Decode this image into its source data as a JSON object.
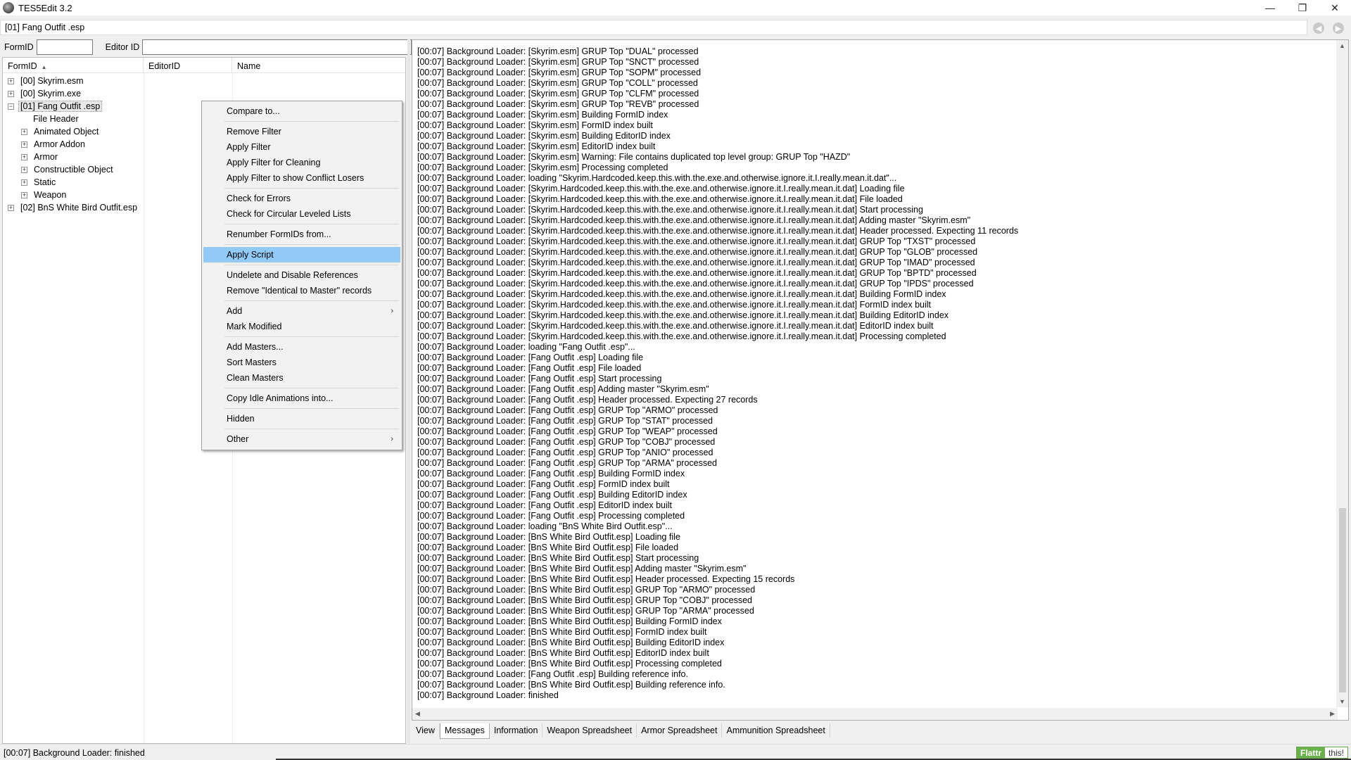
{
  "window": {
    "title": "TES5Edit 3.2",
    "controls": {
      "minimize": "—",
      "restore": "❐",
      "close": "✕"
    }
  },
  "pathbar": {
    "path": "[01] Fang Outfit .esp"
  },
  "nav": {
    "back": "◀",
    "forward": "▶"
  },
  "filter": {
    "formid_label": "FormID",
    "editorid_label": "Editor ID",
    "formid_value": "",
    "editorid_value": ""
  },
  "tree": {
    "columns": {
      "formid": "FormID",
      "editorid": "EditorID",
      "name": "Name"
    },
    "rows": [
      {
        "label": "[00] Skyrim.esm",
        "expander": "+",
        "level": 0
      },
      {
        "label": "[00] Skyrim.exe",
        "expander": "+",
        "level": 0
      },
      {
        "label": "[01] Fang Outfit .esp",
        "expander": "−",
        "level": 0,
        "selected": true
      },
      {
        "label": "File Header",
        "expander": "",
        "level": 1
      },
      {
        "label": "Animated Object",
        "expander": "+",
        "level": 1
      },
      {
        "label": "Armor Addon",
        "expander": "+",
        "level": 1
      },
      {
        "label": "Armor",
        "expander": "+",
        "level": 1
      },
      {
        "label": "Constructible Object",
        "expander": "+",
        "level": 1
      },
      {
        "label": "Static",
        "expander": "+",
        "level": 1
      },
      {
        "label": "Weapon",
        "expander": "+",
        "level": 1
      },
      {
        "label": "[02] BnS White Bird Outfit.esp",
        "expander": "+",
        "level": 0
      }
    ]
  },
  "context_menu": {
    "compare": "Compare to...",
    "remove_filter": "Remove Filter",
    "apply_filter": "Apply Filter",
    "apply_filter_cleaning": "Apply Filter for Cleaning",
    "apply_filter_conflict": "Apply Filter to show Conflict Losers",
    "check_errors": "Check for Errors",
    "check_circular": "Check for Circular Leveled Lists",
    "renumber": "Renumber FormIDs from...",
    "apply_script": "Apply Script",
    "undelete": "Undelete and Disable References",
    "remove_itm": "Remove \"Identical to Master\" records",
    "add": "Add",
    "mark_modified": "Mark Modified",
    "add_masters": "Add Masters...",
    "sort_masters": "Sort Masters",
    "clean_masters": "Clean Masters",
    "copy_idle": "Copy Idle Animations into...",
    "hidden": "Hidden",
    "other": "Other",
    "submenu_arrow": "›"
  },
  "log": {
    "lines": [
      "[00:07] Background Loader: [Skyrim.esm] GRUP Top \"DUAL\" processed",
      "[00:07] Background Loader: [Skyrim.esm] GRUP Top \"SNCT\" processed",
      "[00:07] Background Loader: [Skyrim.esm] GRUP Top \"SOPM\" processed",
      "[00:07] Background Loader: [Skyrim.esm] GRUP Top \"COLL\" processed",
      "[00:07] Background Loader: [Skyrim.esm] GRUP Top \"CLFM\" processed",
      "[00:07] Background Loader: [Skyrim.esm] GRUP Top \"REVB\" processed",
      "[00:07] Background Loader: [Skyrim.esm] Building FormID index",
      "[00:07] Background Loader: [Skyrim.esm] FormID index built",
      "[00:07] Background Loader: [Skyrim.esm] Building EditorID index",
      "[00:07] Background Loader: [Skyrim.esm] EditorID index built",
      "[00:07] Background Loader: [Skyrim.esm] Warning: File contains duplicated top level group: GRUP Top \"HAZD\"",
      "[00:07] Background Loader: [Skyrim.esm] Processing completed",
      "[00:07] Background Loader: loading \"Skyrim.Hardcoded.keep.this.with.the.exe.and.otherwise.ignore.it.I.really.mean.it.dat\"...",
      "[00:07] Background Loader: [Skyrim.Hardcoded.keep.this.with.the.exe.and.otherwise.ignore.it.I.really.mean.it.dat] Loading file",
      "[00:07] Background Loader: [Skyrim.Hardcoded.keep.this.with.the.exe.and.otherwise.ignore.it.I.really.mean.it.dat] File loaded",
      "[00:07] Background Loader: [Skyrim.Hardcoded.keep.this.with.the.exe.and.otherwise.ignore.it.I.really.mean.it.dat] Start processing",
      "[00:07] Background Loader: [Skyrim.Hardcoded.keep.this.with.the.exe.and.otherwise.ignore.it.I.really.mean.it.dat] Adding master \"Skyrim.esm\"",
      "[00:07] Background Loader: [Skyrim.Hardcoded.keep.this.with.the.exe.and.otherwise.ignore.it.I.really.mean.it.dat] Header processed. Expecting 11 records",
      "[00:07] Background Loader: [Skyrim.Hardcoded.keep.this.with.the.exe.and.otherwise.ignore.it.I.really.mean.it.dat] GRUP Top \"TXST\" processed",
      "[00:07] Background Loader: [Skyrim.Hardcoded.keep.this.with.the.exe.and.otherwise.ignore.it.I.really.mean.it.dat] GRUP Top \"GLOB\" processed",
      "[00:07] Background Loader: [Skyrim.Hardcoded.keep.this.with.the.exe.and.otherwise.ignore.it.I.really.mean.it.dat] GRUP Top \"IMAD\" processed",
      "[00:07] Background Loader: [Skyrim.Hardcoded.keep.this.with.the.exe.and.otherwise.ignore.it.I.really.mean.it.dat] GRUP Top \"BPTD\" processed",
      "[00:07] Background Loader: [Skyrim.Hardcoded.keep.this.with.the.exe.and.otherwise.ignore.it.I.really.mean.it.dat] GRUP Top \"IPDS\" processed",
      "[00:07] Background Loader: [Skyrim.Hardcoded.keep.this.with.the.exe.and.otherwise.ignore.it.I.really.mean.it.dat] Building FormID index",
      "[00:07] Background Loader: [Skyrim.Hardcoded.keep.this.with.the.exe.and.otherwise.ignore.it.I.really.mean.it.dat] FormID index built",
      "[00:07] Background Loader: [Skyrim.Hardcoded.keep.this.with.the.exe.and.otherwise.ignore.it.I.really.mean.it.dat] Building EditorID index",
      "[00:07] Background Loader: [Skyrim.Hardcoded.keep.this.with.the.exe.and.otherwise.ignore.it.I.really.mean.it.dat] EditorID index built",
      "[00:07] Background Loader: [Skyrim.Hardcoded.keep.this.with.the.exe.and.otherwise.ignore.it.I.really.mean.it.dat] Processing completed",
      "[00:07] Background Loader: loading \"Fang Outfit .esp\"...",
      "[00:07] Background Loader: [Fang Outfit .esp] Loading file",
      "[00:07] Background Loader: [Fang Outfit .esp] File loaded",
      "[00:07] Background Loader: [Fang Outfit .esp] Start processing",
      "[00:07] Background Loader: [Fang Outfit .esp] Adding master \"Skyrim.esm\"",
      "[00:07] Background Loader: [Fang Outfit .esp] Header processed. Expecting 27 records",
      "[00:07] Background Loader: [Fang Outfit .esp] GRUP Top \"ARMO\" processed",
      "[00:07] Background Loader: [Fang Outfit .esp] GRUP Top \"STAT\" processed",
      "[00:07] Background Loader: [Fang Outfit .esp] GRUP Top \"WEAP\" processed",
      "[00:07] Background Loader: [Fang Outfit .esp] GRUP Top \"COBJ\" processed",
      "[00:07] Background Loader: [Fang Outfit .esp] GRUP Top \"ANIO\" processed",
      "[00:07] Background Loader: [Fang Outfit .esp] GRUP Top \"ARMA\" processed",
      "[00:07] Background Loader: [Fang Outfit .esp] Building FormID index",
      "[00:07] Background Loader: [Fang Outfit .esp] FormID index built",
      "[00:07] Background Loader: [Fang Outfit .esp] Building EditorID index",
      "[00:07] Background Loader: [Fang Outfit .esp] EditorID index built",
      "[00:07] Background Loader: [Fang Outfit .esp] Processing completed",
      "[00:07] Background Loader: loading \"BnS White Bird Outfit.esp\"...",
      "[00:07] Background Loader: [BnS White Bird Outfit.esp] Loading file",
      "[00:07] Background Loader: [BnS White Bird Outfit.esp] File loaded",
      "[00:07] Background Loader: [BnS White Bird Outfit.esp] Start processing",
      "[00:07] Background Loader: [BnS White Bird Outfit.esp] Adding master \"Skyrim.esm\"",
      "[00:07] Background Loader: [BnS White Bird Outfit.esp] Header processed. Expecting 15 records",
      "[00:07] Background Loader: [BnS White Bird Outfit.esp] GRUP Top \"ARMO\" processed",
      "[00:07] Background Loader: [BnS White Bird Outfit.esp] GRUP Top \"COBJ\" processed",
      "[00:07] Background Loader: [BnS White Bird Outfit.esp] GRUP Top \"ARMA\" processed",
      "[00:07] Background Loader: [BnS White Bird Outfit.esp] Building FormID index",
      "[00:07] Background Loader: [BnS White Bird Outfit.esp] FormID index built",
      "[00:07] Background Loader: [BnS White Bird Outfit.esp] Building EditorID index",
      "[00:07] Background Loader: [BnS White Bird Outfit.esp] EditorID index built",
      "[00:07] Background Loader: [BnS White Bird Outfit.esp] Processing completed",
      "[00:07] Background Loader: [Fang Outfit .esp] Building reference info.",
      "[00:07] Background Loader: [BnS White Bird Outfit.esp] Building reference info.",
      "[00:07] Background Loader: finished"
    ]
  },
  "tabs": {
    "view": "View",
    "messages": "Messages",
    "information": "Information",
    "weapon_spreadsheet": "Weapon Spreadsheet",
    "armor_spreadsheet": "Armor Spreadsheet",
    "ammunition_spreadsheet": "Ammunition Spreadsheet",
    "active": "Messages"
  },
  "status": {
    "text": "[00:07] Background Loader: finished",
    "flattr_a": "Flattr",
    "flattr_b": "this!"
  },
  "colors": {
    "menu_highlight": "#91c9f7",
    "flattr_green": "#6ab04c"
  }
}
